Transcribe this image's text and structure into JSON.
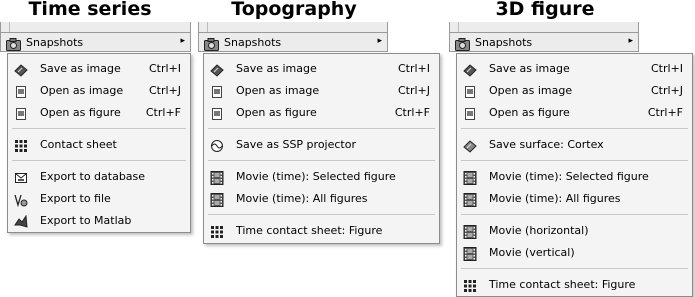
{
  "panels": [
    {
      "title": "Time series",
      "bar_label": "Snapshots",
      "items": [
        {
          "label": "Save as image",
          "shortcut": "Ctrl+I"
        },
        {
          "label": "Open as image",
          "shortcut": "Ctrl+J"
        },
        {
          "label": "Open as figure",
          "shortcut": "Ctrl+F"
        },
        {
          "label": "Contact sheet"
        },
        {
          "label": "Export to database"
        },
        {
          "label": "Export to file"
        },
        {
          "label": "Export to Matlab"
        }
      ]
    },
    {
      "title": "Topography",
      "bar_label": "Snapshots",
      "items": [
        {
          "label": "Save as image",
          "shortcut": "Ctrl+I"
        },
        {
          "label": "Open as image",
          "shortcut": "Ctrl+J"
        },
        {
          "label": "Open as figure",
          "shortcut": "Ctrl+F"
        },
        {
          "label": "Save as SSP projector"
        },
        {
          "label": "Movie (time): Selected figure"
        },
        {
          "label": "Movie (time): All figures"
        },
        {
          "label": "Time contact sheet: Figure"
        }
      ]
    },
    {
      "title": "3D figure",
      "bar_label": "Snapshots",
      "items": [
        {
          "label": "Save as image",
          "shortcut": "Ctrl+I"
        },
        {
          "label": "Open as image",
          "shortcut": "Ctrl+J"
        },
        {
          "label": "Open as figure",
          "shortcut": "Ctrl+F"
        },
        {
          "label": "Save surface: Cortex"
        },
        {
          "label": "Movie (time): Selected figure"
        },
        {
          "label": "Movie (time): All figures"
        },
        {
          "label": "Movie (horizontal)"
        },
        {
          "label": "Movie (vertical)"
        },
        {
          "label": "Time contact sheet: Figure"
        }
      ]
    }
  ],
  "icons": {
    "camera": "camera-icon",
    "arrow": "▸"
  }
}
